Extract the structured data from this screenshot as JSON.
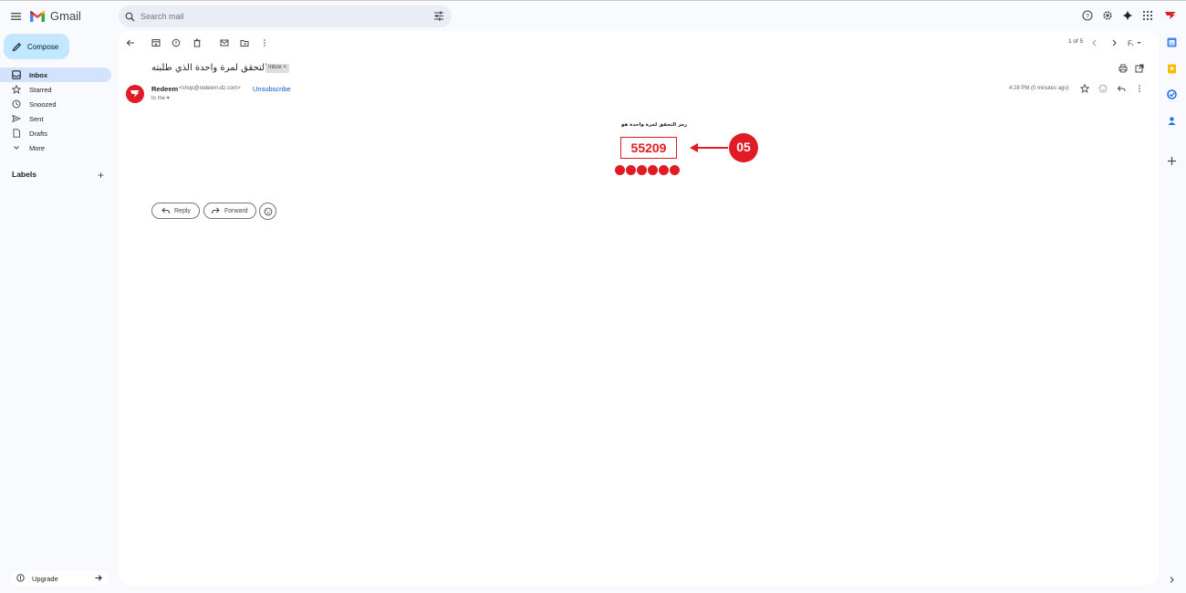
{
  "app": {
    "name": "Gmail"
  },
  "search": {
    "placeholder": "Search mail"
  },
  "sidebar": {
    "compose_label": "Compose",
    "items": [
      {
        "label": "Inbox",
        "icon": "inbox-icon"
      },
      {
        "label": "Starred",
        "icon": "star-icon"
      },
      {
        "label": "Snoozed",
        "icon": "clock-icon"
      },
      {
        "label": "Sent",
        "icon": "send-icon"
      },
      {
        "label": "Drafts",
        "icon": "draft-icon"
      },
      {
        "label": "More",
        "icon": "chevron-down-icon"
      }
    ],
    "labels_header": "Labels",
    "upgrade_label": "Upgrade"
  },
  "toolbar": {
    "pager": "1 of 5"
  },
  "email": {
    "subject": "رمز التحقق لمرة واحدة الذي طلبته",
    "label_chip": "Inbox",
    "sender_name": "Redeem",
    "sender_email": "<shop@redeem-dz.com>",
    "unsubscribe": "Unsubscribe",
    "to": "to me",
    "time": "4:28 PM (0 minutes ago)",
    "body_label": "رمز التحقق لمرة واحدة هو",
    "otp_code": "55209",
    "annotation": "05"
  },
  "actions": {
    "reply": "Reply",
    "forward": "Forward"
  },
  "colors": {
    "brand_red": "#e01b24",
    "accent_blue": "#0b57d0",
    "compose_bg": "#c2e7ff",
    "active_nav": "#d3e3fd"
  }
}
